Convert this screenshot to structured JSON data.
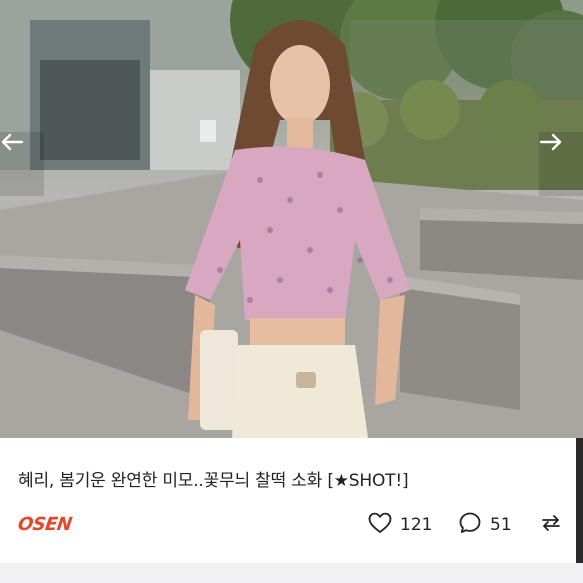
{
  "article": {
    "caption": "혜리, 봄기운 완연한 미모..꽃무늬 찰떡 소화 [★SHOT!]",
    "source_logo": "OSEN",
    "likes": "121",
    "comments": "51"
  },
  "photo": {
    "alt": "street photo of a woman in a floral crop blouse and white jeans"
  },
  "icons": {
    "prev": "arrow-left-icon",
    "next": "arrow-right-icon",
    "like": "heart-icon",
    "comment": "comment-bubble-icon",
    "share": "share-icon"
  },
  "colors": {
    "logo": "#e8452a",
    "text": "#222222",
    "strip": "#f1f1f3"
  }
}
